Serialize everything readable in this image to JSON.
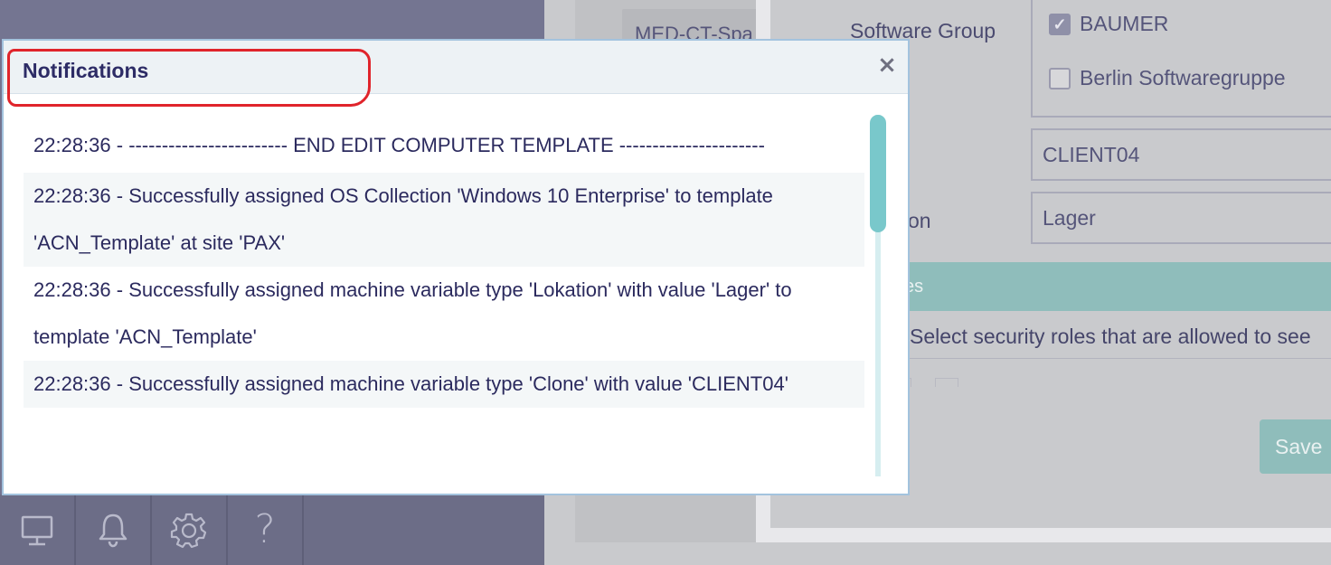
{
  "background": {
    "pill_text": "MED-CT-Spa",
    "form": {
      "software_group_label": "Software Group",
      "software_groups": [
        {
          "label": "BAUMER",
          "checked": true
        },
        {
          "label": "Berlin Softwaregruppe",
          "checked": false
        }
      ],
      "clone_value": "CLIENT04",
      "location_label_fragment": "on",
      "location_value": "Lager",
      "roles_header_fragment": "es",
      "roles_text": "Select security roles that are allowed to see",
      "save_label": "Save"
    }
  },
  "bottom_bar": {
    "items": [
      {
        "name": "computer-icon"
      },
      {
        "name": "bell-icon"
      },
      {
        "name": "gear-icon"
      },
      {
        "name": "help-icon",
        "glyph": "?"
      }
    ]
  },
  "dialog": {
    "title": "Notifications",
    "close_glyph": "×",
    "entries": [
      "22:28:36 - ------------------------ END EDIT COMPUTER TEMPLATE ----------------------",
      "22:28:36 - Successfully assigned OS Collection 'Windows 10 Enterprise' to template 'ACN_Template' at site 'PAX'",
      "22:28:36 - Successfully assigned machine variable type 'Lokation' with value 'Lager' to template 'ACN_Template'",
      "22:28:36 - Successfully assigned machine variable type 'Clone' with value 'CLIENT04'"
    ]
  },
  "colors": {
    "accent_teal": "#79c8cb",
    "annotation_red": "#e0242b",
    "title_navy": "#2d2c66"
  }
}
